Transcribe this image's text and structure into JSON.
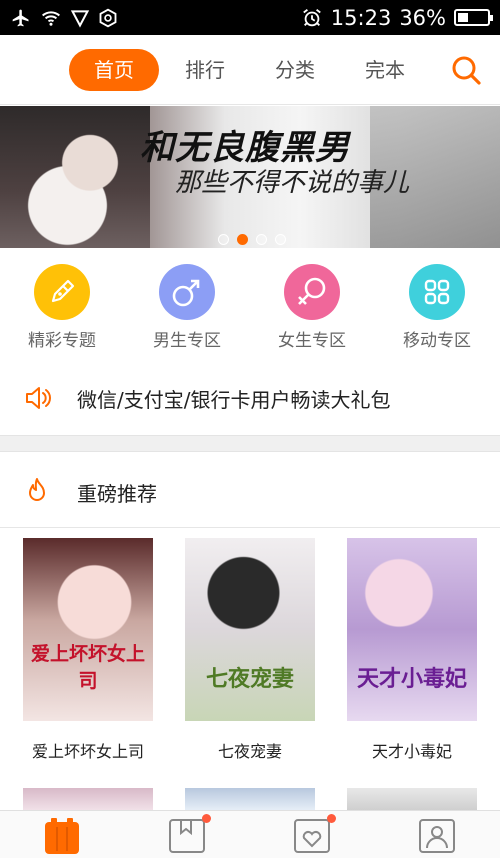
{
  "status_bar": {
    "time": "15:23",
    "battery_percent": "36%",
    "battery_level": 0.36,
    "icons": [
      "airplane-icon",
      "wifi-icon",
      "signal-icon",
      "shield-icon",
      "alarm-icon",
      "battery-icon"
    ]
  },
  "top_nav": {
    "tabs": [
      {
        "label": "首页",
        "active": true
      },
      {
        "label": "排行",
        "active": false
      },
      {
        "label": "分类",
        "active": false
      },
      {
        "label": "完本",
        "active": false
      }
    ],
    "search_icon": "search-icon",
    "accent_color": "#ff6a00"
  },
  "banner": {
    "title": "和无良腹黑男",
    "subtitle": "那些不得不说的事儿",
    "slides": 4,
    "active_slide": 2
  },
  "categories": [
    {
      "label": "精彩专题",
      "icon": "pen-nib-icon",
      "color": "#ffc107"
    },
    {
      "label": "男生专区",
      "icon": "male-icon",
      "color": "#8c9ef5"
    },
    {
      "label": "女生专区",
      "icon": "female-icon",
      "color": "#f0679a"
    },
    {
      "label": "移动专区",
      "icon": "grid-icon",
      "color": "#3fd0dc"
    }
  ],
  "notice": {
    "icon": "speaker-icon",
    "text": "微信/支付宝/银行卡用户畅读大礼包"
  },
  "section": {
    "icon": "flame-icon",
    "title": "重磅推荐"
  },
  "books": [
    {
      "title": "爱上坏坏女上司",
      "cover_text": "爱上坏坏女上司"
    },
    {
      "title": "七夜宠妻",
      "cover_text": "七夜宠妻"
    },
    {
      "title": "天才小毒妃",
      "cover_text": "天才小毒妃"
    }
  ],
  "bottom_bar": {
    "items": [
      {
        "icon": "bookshelf-icon",
        "active": true,
        "badge": false
      },
      {
        "icon": "bookmark-icon",
        "active": false,
        "badge": true
      },
      {
        "icon": "heart-icon",
        "active": false,
        "badge": true
      },
      {
        "icon": "user-icon",
        "active": false,
        "badge": false
      }
    ]
  }
}
